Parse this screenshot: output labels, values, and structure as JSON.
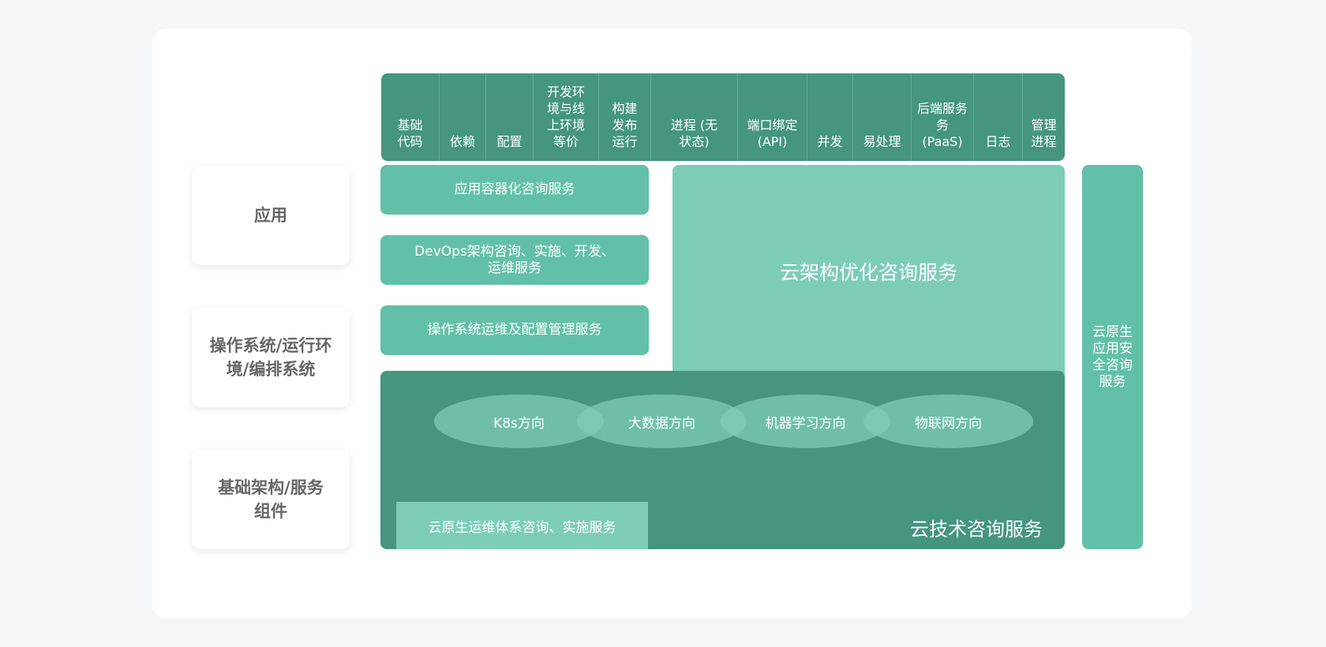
{
  "header": {
    "cells": [
      "基础\n代码",
      "依赖",
      "配置",
      "开发环\n境与线\n上环境\n等价",
      "构建\n发布\n运行",
      "进程 (无\n状态)",
      "端口绑定\n(API)",
      "并发",
      "易处理",
      "后端服务\n务\n(PaaS)",
      "日志",
      "管理\n进程"
    ]
  },
  "layers": {
    "application": "应用",
    "os": "操作系统/运行环\n境/编排系统",
    "infra": "基础架构/服务\n组件"
  },
  "services": {
    "containerization": "应用容器化咨询服务",
    "devops": "DevOps架构咨询、实施、开发、\n运维服务",
    "os_ops": "操作系统运维及配置管理服务",
    "cloud_arch": "云架构优化咨询服务",
    "cloud_native_ops": "云原生运维体系咨询、实施服务",
    "cloud_tech": "云技术咨询服务",
    "security": "云原生\n应用安\n全咨询\n服务"
  },
  "directions": [
    "K8s方向",
    "大数据方向",
    "机器学习方向",
    "物联网方向"
  ]
}
